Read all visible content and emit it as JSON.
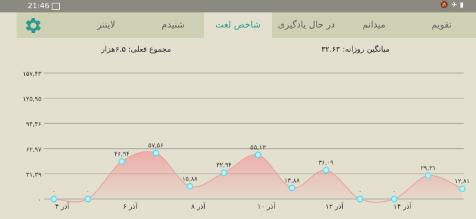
{
  "status": {
    "time": "21:46"
  },
  "tabs": [
    {
      "label": "تقویم",
      "active": false
    },
    {
      "label": "میدانم",
      "active": false
    },
    {
      "label": "در حال یادگیری",
      "active": false
    },
    {
      "label": "شاخص لغت",
      "active": true
    },
    {
      "label": "شنیدم",
      "active": false
    },
    {
      "label": "لایتنر",
      "active": false
    }
  ],
  "summary": {
    "avg_label": "میانگین روزانه: ۳۲.۶۳",
    "total_label": "مجموع فعلی: ۶.۵هزار"
  },
  "colors": {
    "accent": "#2a9a8e",
    "curve": "#e7a1a1",
    "point": "#5fd6e8"
  },
  "chart_data": {
    "type": "area",
    "yticks": [
      0,
      31.39,
      62.97,
      94.46,
      125.95,
      157.43
    ],
    "ytick_labels": [
      "۰",
      "۳۱,۳۹",
      "۶۲,۹۷",
      "۹۴,۴۶",
      "۱۲۵,۹۵",
      "۱۵۷,۴۳"
    ],
    "ylim": [
      0,
      157.43
    ],
    "x_tick_labels": [
      "۴ آذر",
      "۶ آذر",
      "۸ آذر",
      "۱۰ آذر",
      "۱۲ آذر",
      "۱۴ آذر"
    ],
    "x_tick_indices": [
      0,
      2,
      4,
      6,
      8,
      10
    ],
    "values": [
      0,
      0,
      46.94,
      57.56,
      15.88,
      32.94,
      55.13,
      13.88,
      36.09,
      0,
      0,
      29.31,
      12.81
    ],
    "value_labels": [
      "۰",
      "۰",
      "۴۶,۹۴",
      "۵۷,۵۶",
      "۱۵,۸۸",
      "۳۲,۹۴",
      "۵۵,۱۳",
      "۱۳,۸۸",
      "۳۶,۰۹",
      "۰",
      "۰",
      "۲۹,۳۱",
      "۱۲,۸۱"
    ]
  }
}
